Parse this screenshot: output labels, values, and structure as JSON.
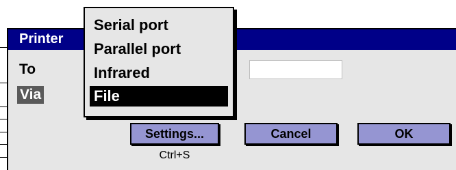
{
  "dialog": {
    "title": "Printer",
    "to_label": "To",
    "via_label": "Via",
    "to_value": ""
  },
  "dropdown": {
    "options": [
      "Serial port",
      "Parallel port",
      "Infrared",
      "File"
    ],
    "selected": "File"
  },
  "buttons": {
    "settings_label": "Settings...",
    "settings_shortcut": "Ctrl+S",
    "cancel_label": "Cancel",
    "ok_label": "OK"
  },
  "colors": {
    "titlebar": "#000088",
    "button": "#9595d2",
    "dialog_bg": "#e6e6e6",
    "selection": "#000000"
  }
}
